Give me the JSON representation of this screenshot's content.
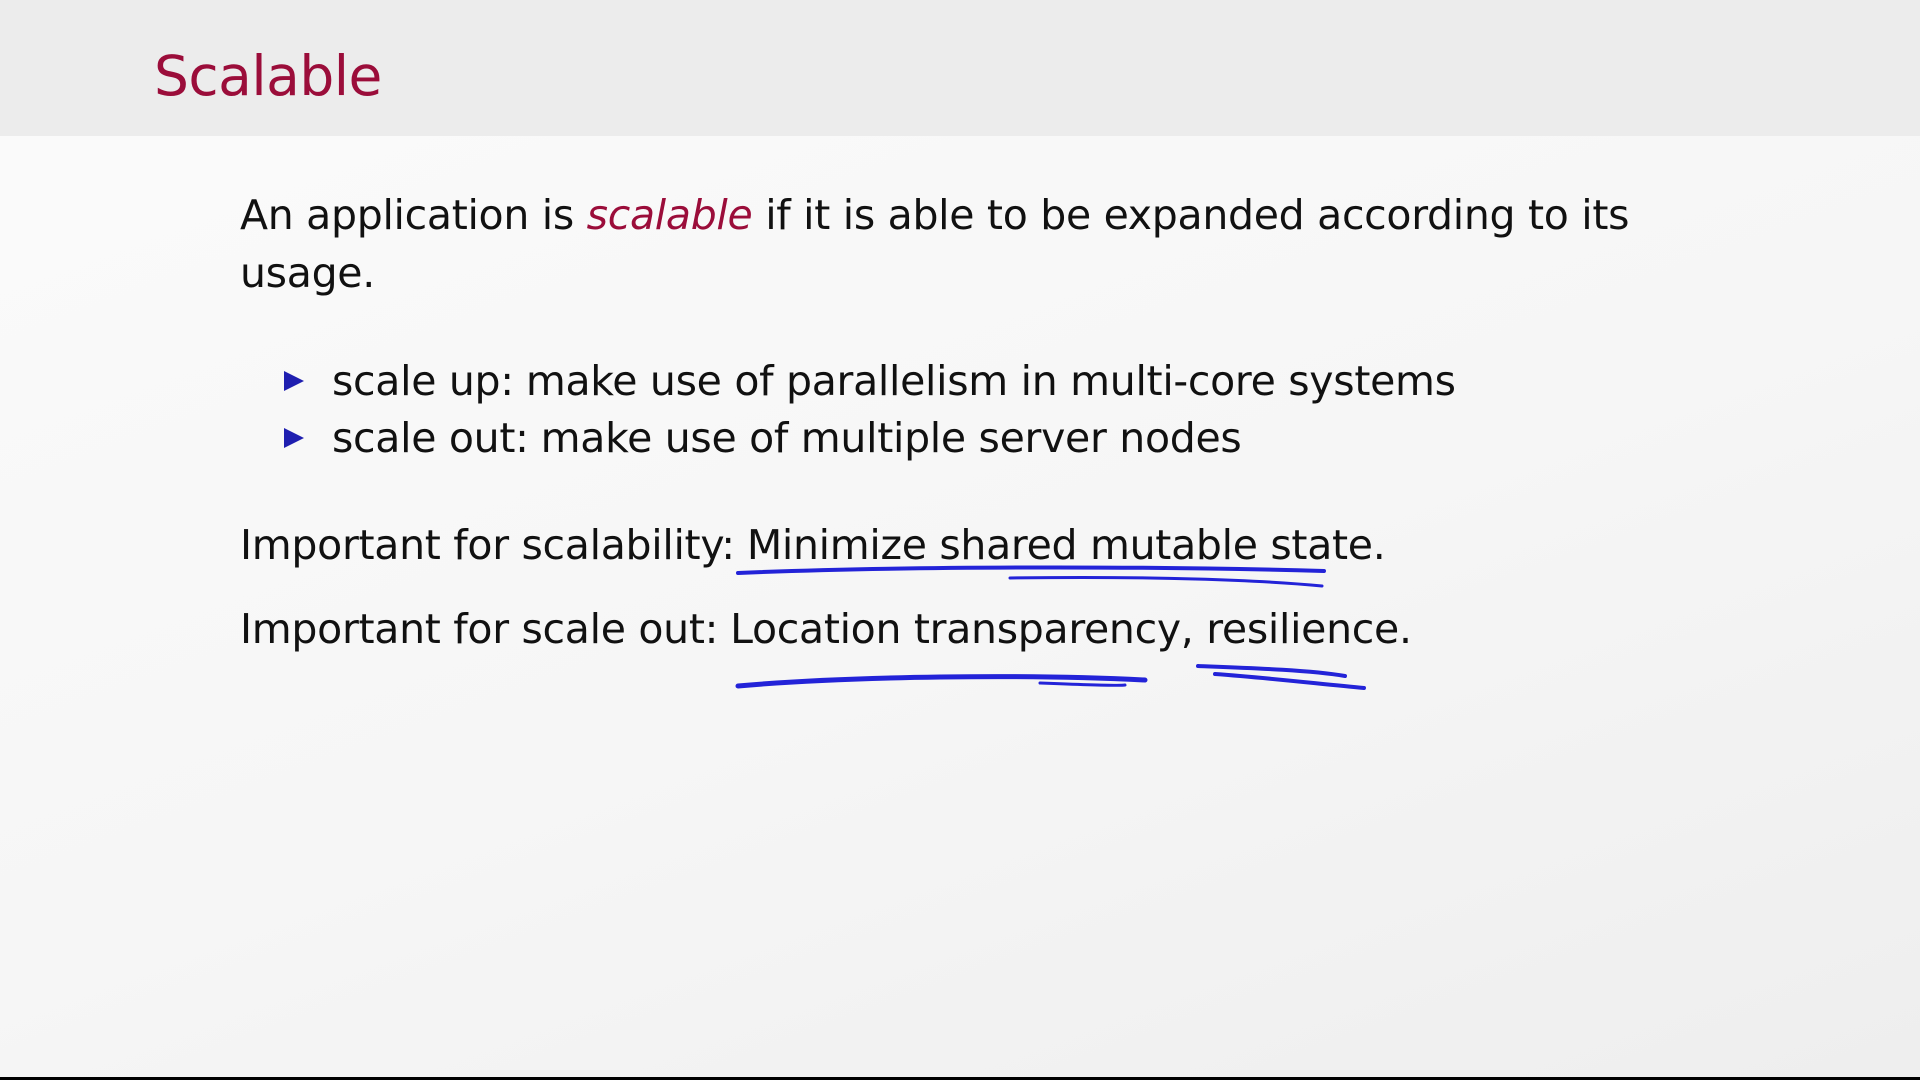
{
  "slide": {
    "title": "Scalable",
    "intro": {
      "before": "An application is",
      "emphasis": "scalable",
      "after_line1": "if it is able to be expanded according to its",
      "line2": "usage."
    },
    "bullets": [
      {
        "label": "scale up:",
        "text": "make use of parallelism in multi-core systems"
      },
      {
        "label": "scale out:",
        "text": "make use of multiple server nodes"
      }
    ],
    "important_scalability": {
      "label": "Important for scalability:",
      "value": "Minimize shared mutable state."
    },
    "important_scale_out": {
      "label": "Important for scale out:",
      "value": "Location transparency, resilience."
    }
  },
  "colors": {
    "title": "#9b0d3a",
    "emphasis": "#9b0d3a",
    "bullet": "#1f1fb0",
    "ink_annotation": "#2323d8"
  }
}
